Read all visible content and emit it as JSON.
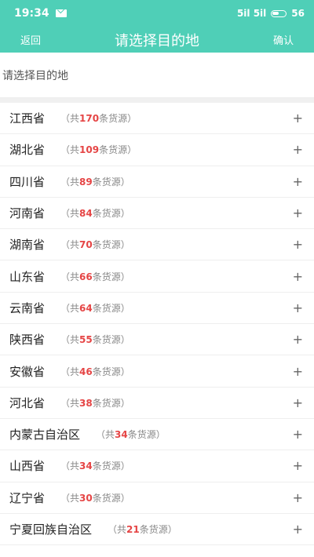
{
  "status": {
    "time": "19:34",
    "signal": "5il 5il",
    "battery": "56"
  },
  "nav": {
    "back_label": "返回",
    "title": "请选择目的地",
    "confirm_label": "确认"
  },
  "prompt": "请选择目的地",
  "count_prefix": "（共",
  "count_suffix": "条货源）",
  "plus": "+",
  "provinces": [
    {
      "name": "江西省",
      "count": "170"
    },
    {
      "name": "湖北省",
      "count": "109"
    },
    {
      "name": "四川省",
      "count": "89"
    },
    {
      "name": "河南省",
      "count": "84"
    },
    {
      "name": "湖南省",
      "count": "70"
    },
    {
      "name": "山东省",
      "count": "66"
    },
    {
      "name": "云南省",
      "count": "64"
    },
    {
      "name": "陕西省",
      "count": "55"
    },
    {
      "name": "安徽省",
      "count": "46"
    },
    {
      "name": "河北省",
      "count": "38"
    },
    {
      "name": "内蒙古自治区",
      "count": "34"
    },
    {
      "name": "山西省",
      "count": "34"
    },
    {
      "name": "辽宁省",
      "count": "30"
    },
    {
      "name": "宁夏回族自治区",
      "count": "21"
    }
  ]
}
